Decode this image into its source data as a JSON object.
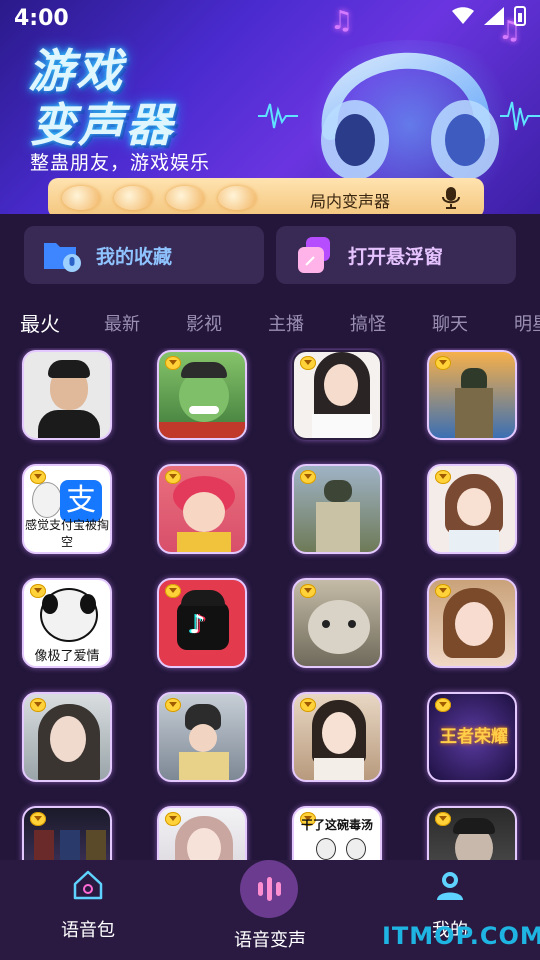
{
  "status_bar": {
    "time": "4:00"
  },
  "banner": {
    "title_line1": "游戏",
    "title_line2": "变声器",
    "subtitle": "整蛊朋友，游戏娱乐",
    "bar_label": "局内变声器"
  },
  "quick_actions": [
    {
      "label": "我的收藏",
      "icon": "folder-mic-icon"
    },
    {
      "label": "打开悬浮窗",
      "icon": "floating-window-icon"
    }
  ],
  "categories": [
    "最火",
    "最新",
    "影视",
    "主播",
    "搞怪",
    "聊天",
    "明星"
  ],
  "active_category": "最火",
  "voice_packs": [
    {
      "caption": "",
      "vip": false
    },
    {
      "caption": "",
      "vip": true
    },
    {
      "caption": "",
      "vip": true
    },
    {
      "caption": "",
      "vip": true
    },
    {
      "caption": "感觉支付宝被掏空",
      "vip": true
    },
    {
      "caption": "",
      "vip": true
    },
    {
      "caption": "",
      "vip": true
    },
    {
      "caption": "",
      "vip": true
    },
    {
      "caption": "像极了爱情",
      "vip": true
    },
    {
      "caption": "",
      "vip": true
    },
    {
      "caption": "",
      "vip": true
    },
    {
      "caption": "",
      "vip": true
    },
    {
      "caption": "",
      "vip": true
    },
    {
      "caption": "",
      "vip": true
    },
    {
      "caption": "",
      "vip": true
    },
    {
      "caption": "王者荣耀",
      "vip": true
    },
    {
      "caption": "",
      "vip": true
    },
    {
      "caption": "",
      "vip": true
    },
    {
      "caption": "干了这碗毒汤",
      "vip": true
    },
    {
      "caption": "",
      "vip": true
    }
  ],
  "bottom_nav": [
    {
      "label": "语音包",
      "icon": "home-icon"
    },
    {
      "label": "语音变声",
      "icon": "voice-wave-icon"
    },
    {
      "label": "我的",
      "icon": "profile-icon"
    }
  ],
  "watermark": "ITMOP.COM"
}
